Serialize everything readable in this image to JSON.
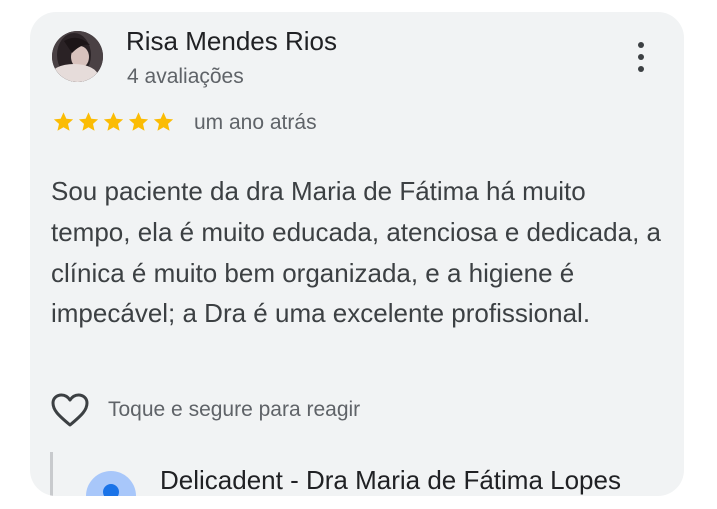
{
  "review": {
    "reviewer_name": "Risa Mendes Rios",
    "review_count": "4 avaliações",
    "rating": 5,
    "rating_max": 5,
    "date": "um ano atrás",
    "text": "Sou paciente da dra Maria de Fátima há muito tempo, ela é muito educada, atenciosa e dedicada, a clínica é muito bem organizada, e a higiene é impecável; a Dra é uma excelente profissional.",
    "react_prompt": "Toque e segure para reagir"
  },
  "owner_reply": {
    "owner_name": "Delicadent - Dra Maria de Fátima Lopes"
  },
  "icons": {
    "menu": "more-vert-icon",
    "reaction": "heart-outline-icon",
    "rating": "star-icon"
  },
  "colors": {
    "card_background": "#f1f3f4",
    "star": "#fbbc04",
    "primary_text": "#202124",
    "secondary_text": "#5f6368",
    "owner_avatar": "#a8c7fa"
  }
}
